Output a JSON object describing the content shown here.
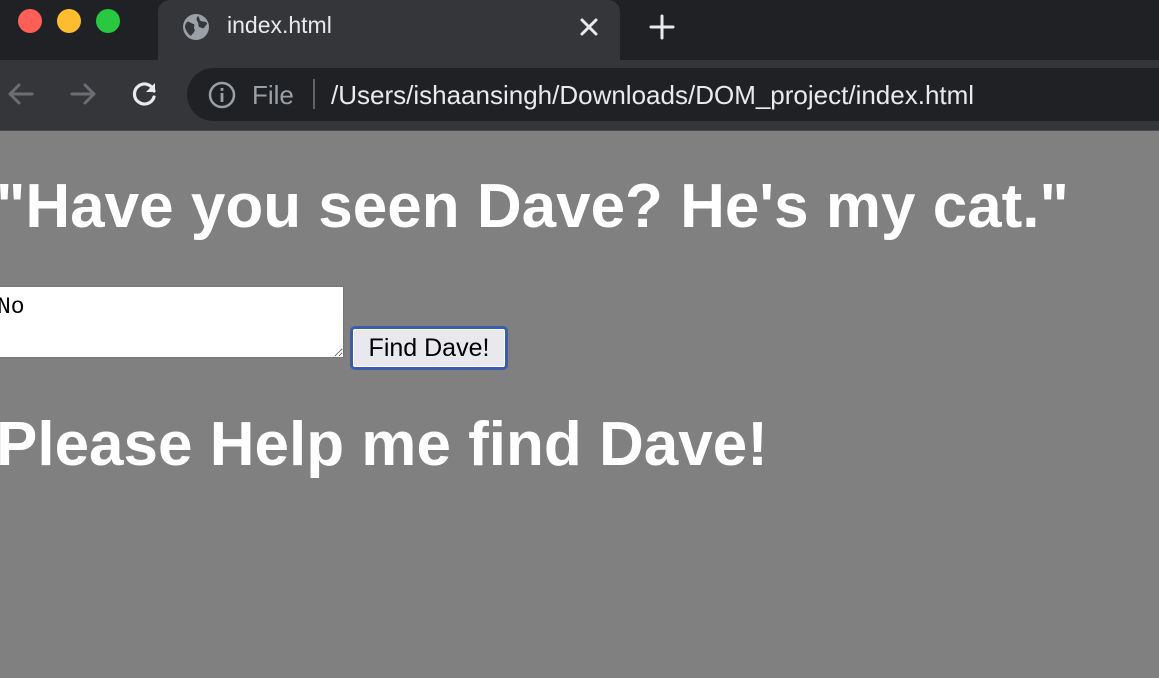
{
  "browser": {
    "tab": {
      "title": "index.html",
      "favicon": "globe-icon"
    },
    "new_tab_icon": "plus-icon",
    "nav": {
      "back_icon": "back-arrow-icon",
      "forward_icon": "forward-arrow-icon",
      "reload_icon": "reload-icon"
    },
    "address_bar": {
      "info_icon": "info-icon",
      "scheme": "File",
      "url": "/Users/ishaansingh/Downloads/DOM_project/index.html"
    },
    "window_controls": [
      "close",
      "minimize",
      "maximize"
    ]
  },
  "page": {
    "background": "#808080",
    "heading": "\"Have you seen Dave? He's my cat.\"",
    "answer_value": "No",
    "find_button_label": "Find Dave!",
    "result_heading": "Please Help me find Dave!"
  }
}
